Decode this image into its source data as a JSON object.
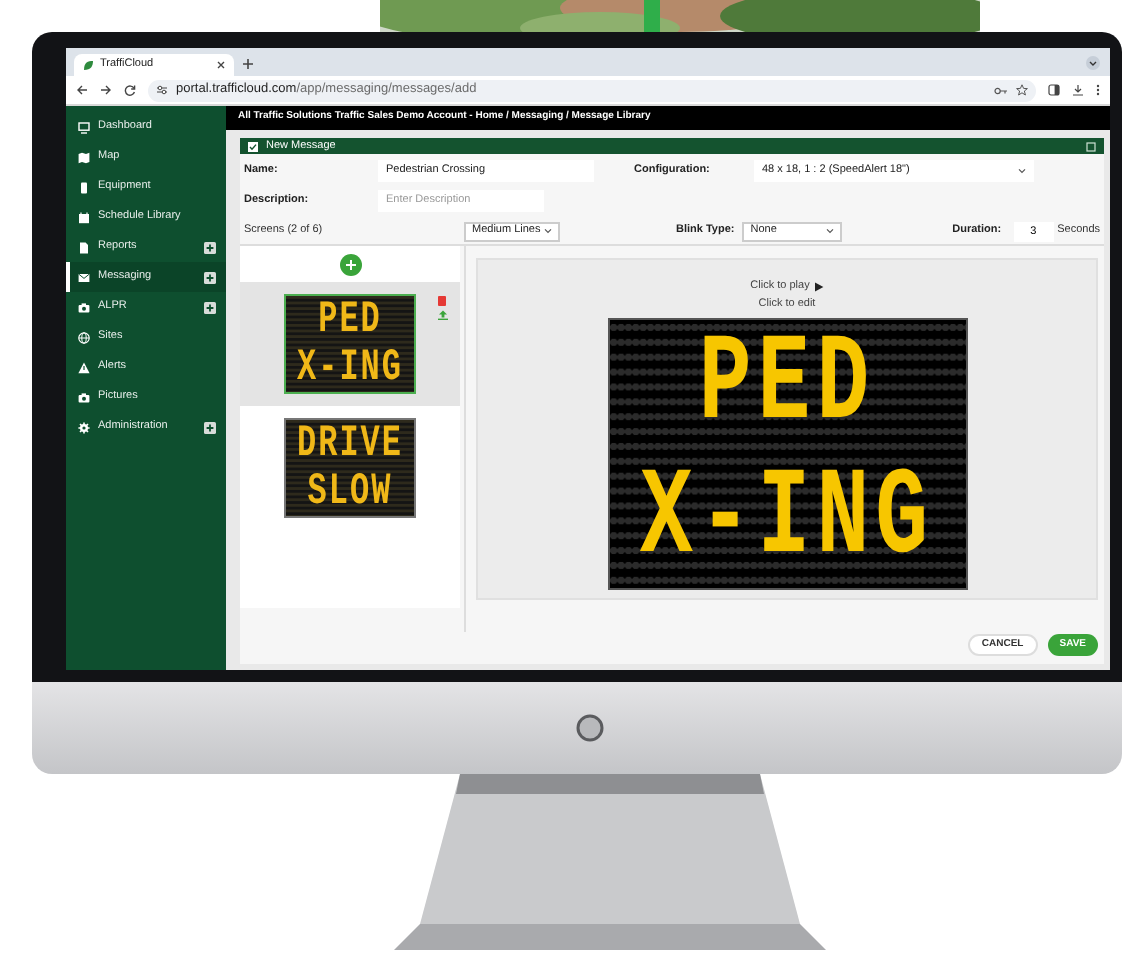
{
  "browser": {
    "tab": {
      "title": "TraffiCloud",
      "selected": true
    },
    "url_host": "portal.trafficloud.com",
    "url_path": "/app/messaging/messages/add"
  },
  "sidebar": {
    "items": [
      {
        "label": "Dashboard",
        "selected": false,
        "expandable": false
      },
      {
        "label": "Map",
        "selected": false,
        "expandable": false
      },
      {
        "label": "Equipment",
        "selected": false,
        "expandable": false
      },
      {
        "label": "Schedule Library",
        "selected": false,
        "expandable": false
      },
      {
        "label": "Reports",
        "selected": false,
        "expandable": true
      },
      {
        "label": "Messaging",
        "selected": true,
        "expandable": true
      },
      {
        "label": "ALPR",
        "selected": false,
        "expandable": true
      },
      {
        "label": "Sites",
        "selected": false,
        "expandable": false
      },
      {
        "label": "Alerts",
        "selected": false,
        "expandable": false
      },
      {
        "label": "Pictures",
        "selected": false,
        "expandable": false
      },
      {
        "label": "Administration",
        "selected": false,
        "expandable": true
      }
    ]
  },
  "breadcrumb": "All Traffic Solutions Traffic Sales Demo Account - Home / Messaging / Message Library",
  "form": {
    "title": "New Message",
    "name": {
      "label": "Name:",
      "value": "Pedestrian Crossing"
    },
    "configuration": {
      "label": "Configuration:",
      "value": "48 x 18, 1 : 2 (SpeedAlert 18\")"
    },
    "description": {
      "label": "Description:",
      "placeholder": "Enter Description"
    }
  },
  "screens": {
    "label": "Screens (2 of 6)",
    "line_style": "Medium Lines",
    "blink_label": "Blink Type:",
    "blink_value": "None",
    "duration_label": "Duration:",
    "duration_value": "3",
    "duration_unit": "Seconds",
    "items": [
      {
        "selected": true,
        "lines": [
          "PED",
          "X-ING"
        ]
      },
      {
        "selected": false,
        "lines": [
          "DRIVE",
          "SLOW"
        ]
      }
    ]
  },
  "preview": {
    "play": "Click to play",
    "edit": "Click to edit",
    "lines": [
      "PED",
      "X-ING"
    ]
  },
  "buttons": [
    {
      "label": "CANCEL",
      "kind": "secondary"
    },
    {
      "label": "SAVE",
      "kind": "primary"
    }
  ]
}
